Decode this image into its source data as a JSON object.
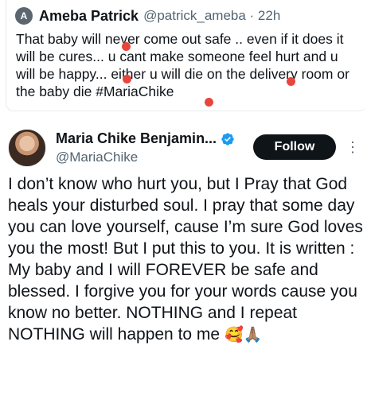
{
  "quoted_tweet": {
    "avatar_letter": "A",
    "author_name": "Ameba Patrick",
    "handle_time": "@patrick_ameba · 22h",
    "text": "That baby will never come out safe .. even if it does it will be cures... u cant make someone feel hurt and u will be happy... either u will die on the delivery room or the baby die #MariaChike"
  },
  "main_tweet": {
    "author_name": "Maria Chike Benjamin...",
    "handle": "@MariaChike",
    "follow_label": "Follow",
    "more_label": "⋮",
    "text": "I don’t know who hurt you, but I Pray that God heals your disturbed soul. I pray that some day you can love yourself, cause I’m sure God loves you the most! But I put this to you. It is written : My baby and I will FOREVER be safe and blessed. I forgive you for your words cause you know no better. NOTHING and I repeat NOTHING will happen to me",
    "emojis": "🥰🙏🏽"
  },
  "colors": {
    "verified_blue": "#1d9bf0",
    "follow_bg": "#0f1419",
    "handle_gray": "#536471",
    "red_mark": "#e8453c"
  },
  "icons": {
    "verified": "verified-badge-icon",
    "more": "more-options-icon"
  }
}
